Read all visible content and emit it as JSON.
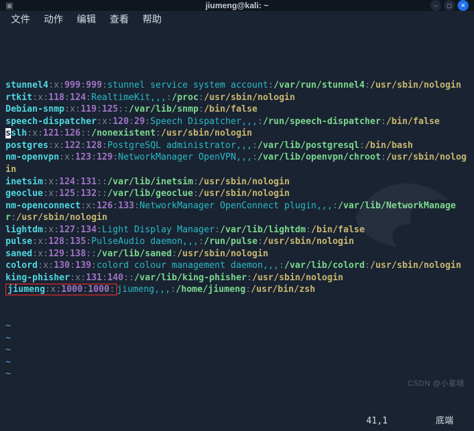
{
  "window": {
    "title": "jiumeng@kali: ~"
  },
  "menu": {
    "items": [
      "文件",
      "动作",
      "编辑",
      "查看",
      "帮助"
    ]
  },
  "lines": [
    {
      "segs": [
        {
          "t": "stunnel4",
          "c": "c-cyan"
        },
        {
          "t": ":",
          "c": "c-gray"
        },
        {
          "t": "x",
          "c": "c-gray"
        },
        {
          "t": ":",
          "c": "c-gray"
        },
        {
          "t": "999",
          "c": "c-purple"
        },
        {
          "t": ":",
          "c": "c-gray"
        },
        {
          "t": "999",
          "c": "c-purple"
        },
        {
          "t": ":",
          "c": "c-gray"
        },
        {
          "t": "stunnel service system account",
          "c": "c-teal"
        },
        {
          "t": ":",
          "c": "c-gray"
        },
        {
          "t": "/var/run/stunnel4",
          "c": "c-green"
        },
        {
          "t": ":",
          "c": "c-gray"
        },
        {
          "t": "/usr/sbin/nologin",
          "c": "c-yellow"
        }
      ]
    },
    {
      "segs": [
        {
          "t": "rtkit",
          "c": "c-cyan"
        },
        {
          "t": ":",
          "c": "c-gray"
        },
        {
          "t": "x",
          "c": "c-gray"
        },
        {
          "t": ":",
          "c": "c-gray"
        },
        {
          "t": "118",
          "c": "c-purple"
        },
        {
          "t": ":",
          "c": "c-gray"
        },
        {
          "t": "124",
          "c": "c-purple"
        },
        {
          "t": ":",
          "c": "c-gray"
        },
        {
          "t": "RealtimeKit,,,",
          "c": "c-teal"
        },
        {
          "t": ":",
          "c": "c-gray"
        },
        {
          "t": "/proc",
          "c": "c-green"
        },
        {
          "t": ":",
          "c": "c-gray"
        },
        {
          "t": "/usr/sbin/nologin",
          "c": "c-yellow"
        }
      ]
    },
    {
      "segs": [
        {
          "t": "Debian-snmp",
          "c": "c-cyan"
        },
        {
          "t": ":",
          "c": "c-gray"
        },
        {
          "t": "x",
          "c": "c-gray"
        },
        {
          "t": ":",
          "c": "c-gray"
        },
        {
          "t": "119",
          "c": "c-purple"
        },
        {
          "t": ":",
          "c": "c-gray"
        },
        {
          "t": "125",
          "c": "c-purple"
        },
        {
          "t": "::",
          "c": "c-gray"
        },
        {
          "t": "/var/lib/snmp",
          "c": "c-green"
        },
        {
          "t": ":",
          "c": "c-gray"
        },
        {
          "t": "/bin/false",
          "c": "c-yellow"
        }
      ]
    },
    {
      "segs": [
        {
          "t": "speech-dispatcher",
          "c": "c-cyan"
        },
        {
          "t": ":",
          "c": "c-gray"
        },
        {
          "t": "x",
          "c": "c-gray"
        },
        {
          "t": ":",
          "c": "c-gray"
        },
        {
          "t": "120",
          "c": "c-purple"
        },
        {
          "t": ":",
          "c": "c-gray"
        },
        {
          "t": "29",
          "c": "c-purple"
        },
        {
          "t": ":",
          "c": "c-gray"
        },
        {
          "t": "Speech Dispatcher,,,",
          "c": "c-teal"
        },
        {
          "t": ":",
          "c": "c-gray"
        },
        {
          "t": "/run/speech-dispatcher",
          "c": "c-green"
        },
        {
          "t": ":",
          "c": "c-gray"
        },
        {
          "t": "/bin/false",
          "c": "c-yellow"
        }
      ]
    },
    {
      "segs": [
        {
          "t": "s",
          "c": "c-cyan",
          "hl": "cursor"
        },
        {
          "t": "slh",
          "c": "c-cyan"
        },
        {
          "t": ":",
          "c": "c-gray"
        },
        {
          "t": "x",
          "c": "c-gray"
        },
        {
          "t": ":",
          "c": "c-gray"
        },
        {
          "t": "121",
          "c": "c-purple"
        },
        {
          "t": ":",
          "c": "c-gray"
        },
        {
          "t": "126",
          "c": "c-purple"
        },
        {
          "t": "::",
          "c": "c-gray"
        },
        {
          "t": "/nonexistent",
          "c": "c-green"
        },
        {
          "t": ":",
          "c": "c-gray"
        },
        {
          "t": "/usr/sbin/nologin",
          "c": "c-yellow"
        }
      ]
    },
    {
      "segs": [
        {
          "t": "postgres",
          "c": "c-cyan"
        },
        {
          "t": ":",
          "c": "c-gray"
        },
        {
          "t": "x",
          "c": "c-gray"
        },
        {
          "t": ":",
          "c": "c-gray"
        },
        {
          "t": "122",
          "c": "c-purple"
        },
        {
          "t": ":",
          "c": "c-gray"
        },
        {
          "t": "128",
          "c": "c-purple"
        },
        {
          "t": ":",
          "c": "c-gray"
        },
        {
          "t": "PostgreSQL administrator,,,",
          "c": "c-teal"
        },
        {
          "t": ":",
          "c": "c-gray"
        },
        {
          "t": "/var/lib/postgresql",
          "c": "c-green"
        },
        {
          "t": ":",
          "c": "c-gray"
        },
        {
          "t": "/bin/bash",
          "c": "c-yellow"
        }
      ]
    },
    {
      "segs": [
        {
          "t": "nm-openvpn",
          "c": "c-cyan"
        },
        {
          "t": ":",
          "c": "c-gray"
        },
        {
          "t": "x",
          "c": "c-gray"
        },
        {
          "t": ":",
          "c": "c-gray"
        },
        {
          "t": "123",
          "c": "c-purple"
        },
        {
          "t": ":",
          "c": "c-gray"
        },
        {
          "t": "129",
          "c": "c-purple"
        },
        {
          "t": ":",
          "c": "c-gray"
        },
        {
          "t": "NetworkManager OpenVPN,,,",
          "c": "c-teal"
        },
        {
          "t": ":",
          "c": "c-gray"
        },
        {
          "t": "/var/lib/openvpn/chroot",
          "c": "c-green"
        },
        {
          "t": ":",
          "c": "c-gray"
        },
        {
          "t": "/usr/sbin/nologin",
          "c": "c-yellow"
        }
      ]
    },
    {
      "segs": [
        {
          "t": "inetsim",
          "c": "c-cyan"
        },
        {
          "t": ":",
          "c": "c-gray"
        },
        {
          "t": "x",
          "c": "c-gray"
        },
        {
          "t": ":",
          "c": "c-gray"
        },
        {
          "t": "124",
          "c": "c-purple"
        },
        {
          "t": ":",
          "c": "c-gray"
        },
        {
          "t": "131",
          "c": "c-purple"
        },
        {
          "t": "::",
          "c": "c-gray"
        },
        {
          "t": "/var/lib/inetsim",
          "c": "c-green"
        },
        {
          "t": ":",
          "c": "c-gray"
        },
        {
          "t": "/usr/sbin/nologin",
          "c": "c-yellow"
        }
      ]
    },
    {
      "segs": [
        {
          "t": "geoclue",
          "c": "c-cyan"
        },
        {
          "t": ":",
          "c": "c-gray"
        },
        {
          "t": "x",
          "c": "c-gray"
        },
        {
          "t": ":",
          "c": "c-gray"
        },
        {
          "t": "125",
          "c": "c-purple"
        },
        {
          "t": ":",
          "c": "c-gray"
        },
        {
          "t": "132",
          "c": "c-purple"
        },
        {
          "t": "::",
          "c": "c-gray"
        },
        {
          "t": "/var/lib/geoclue",
          "c": "c-green"
        },
        {
          "t": ":",
          "c": "c-gray"
        },
        {
          "t": "/usr/sbin/nologin",
          "c": "c-yellow"
        }
      ]
    },
    {
      "segs": [
        {
          "t": "nm-openconnect",
          "c": "c-cyan"
        },
        {
          "t": ":",
          "c": "c-gray"
        },
        {
          "t": "x",
          "c": "c-gray"
        },
        {
          "t": ":",
          "c": "c-gray"
        },
        {
          "t": "126",
          "c": "c-purple"
        },
        {
          "t": ":",
          "c": "c-gray"
        },
        {
          "t": "133",
          "c": "c-purple"
        },
        {
          "t": ":",
          "c": "c-gray"
        },
        {
          "t": "NetworkManager OpenConnect plugin,,,",
          "c": "c-teal"
        },
        {
          "t": ":",
          "c": "c-gray"
        },
        {
          "t": "/var/lib/NetworkManager",
          "c": "c-green"
        },
        {
          "t": ":",
          "c": "c-gray"
        },
        {
          "t": "/usr/sbin/nologin",
          "c": "c-yellow"
        }
      ]
    },
    {
      "segs": [
        {
          "t": "lightdm",
          "c": "c-cyan"
        },
        {
          "t": ":",
          "c": "c-gray"
        },
        {
          "t": "x",
          "c": "c-gray"
        },
        {
          "t": ":",
          "c": "c-gray"
        },
        {
          "t": "127",
          "c": "c-purple"
        },
        {
          "t": ":",
          "c": "c-gray"
        },
        {
          "t": "134",
          "c": "c-purple"
        },
        {
          "t": ":",
          "c": "c-gray"
        },
        {
          "t": "Light Display Manager",
          "c": "c-teal"
        },
        {
          "t": ":",
          "c": "c-gray"
        },
        {
          "t": "/var/lib/lightdm",
          "c": "c-green"
        },
        {
          "t": ":",
          "c": "c-gray"
        },
        {
          "t": "/bin/false",
          "c": "c-yellow"
        }
      ]
    },
    {
      "segs": [
        {
          "t": "pulse",
          "c": "c-cyan"
        },
        {
          "t": ":",
          "c": "c-gray"
        },
        {
          "t": "x",
          "c": "c-gray"
        },
        {
          "t": ":",
          "c": "c-gray"
        },
        {
          "t": "128",
          "c": "c-purple"
        },
        {
          "t": ":",
          "c": "c-gray"
        },
        {
          "t": "135",
          "c": "c-purple"
        },
        {
          "t": ":",
          "c": "c-gray"
        },
        {
          "t": "PulseAudio daemon,,,",
          "c": "c-teal"
        },
        {
          "t": ":",
          "c": "c-gray"
        },
        {
          "t": "/run/pulse",
          "c": "c-green"
        },
        {
          "t": ":",
          "c": "c-gray"
        },
        {
          "t": "/usr/sbin/nologin",
          "c": "c-yellow"
        }
      ]
    },
    {
      "segs": [
        {
          "t": "saned",
          "c": "c-cyan"
        },
        {
          "t": ":",
          "c": "c-gray"
        },
        {
          "t": "x",
          "c": "c-gray"
        },
        {
          "t": ":",
          "c": "c-gray"
        },
        {
          "t": "129",
          "c": "c-purple"
        },
        {
          "t": ":",
          "c": "c-gray"
        },
        {
          "t": "138",
          "c": "c-purple"
        },
        {
          "t": "::",
          "c": "c-gray"
        },
        {
          "t": "/var/lib/saned",
          "c": "c-green"
        },
        {
          "t": ":",
          "c": "c-gray"
        },
        {
          "t": "/usr/sbin/nologin",
          "c": "c-yellow"
        }
      ]
    },
    {
      "segs": [
        {
          "t": "colord",
          "c": "c-cyan"
        },
        {
          "t": ":",
          "c": "c-gray"
        },
        {
          "t": "x",
          "c": "c-gray"
        },
        {
          "t": ":",
          "c": "c-gray"
        },
        {
          "t": "130",
          "c": "c-purple"
        },
        {
          "t": ":",
          "c": "c-gray"
        },
        {
          "t": "139",
          "c": "c-purple"
        },
        {
          "t": ":",
          "c": "c-gray"
        },
        {
          "t": "colord colour management daemon,,,",
          "c": "c-teal"
        },
        {
          "t": ":",
          "c": "c-gray"
        },
        {
          "t": "/var/lib/colord",
          "c": "c-green"
        },
        {
          "t": ":",
          "c": "c-gray"
        },
        {
          "t": "/usr/sbin/nologin",
          "c": "c-yellow"
        }
      ]
    },
    {
      "segs": [
        {
          "t": "king-phisher",
          "c": "c-cyan"
        },
        {
          "t": ":",
          "c": "c-gray"
        },
        {
          "t": "x",
          "c": "c-gray"
        },
        {
          "t": ":",
          "c": "c-gray"
        },
        {
          "t": "131",
          "c": "c-purple"
        },
        {
          "t": ":",
          "c": "c-gray"
        },
        {
          "t": "140",
          "c": "c-purple"
        },
        {
          "t": "::",
          "c": "c-gray"
        },
        {
          "t": "/var/lib/king-phisher",
          "c": "c-green"
        },
        {
          "t": ":",
          "c": "c-gray"
        },
        {
          "t": "/usr/sbin/nologin",
          "c": "c-yellow"
        }
      ]
    },
    {
      "segs": [
        {
          "t": "jiumeng",
          "c": "c-cyan",
          "box": "start"
        },
        {
          "t": ":",
          "c": "c-gray"
        },
        {
          "t": "x",
          "c": "c-gray"
        },
        {
          "t": ":",
          "c": "c-gray"
        },
        {
          "t": "1000",
          "c": "c-purple"
        },
        {
          "t": ":",
          "c": "c-gray"
        },
        {
          "t": "1000",
          "c": "c-purple"
        },
        {
          "t": ":",
          "c": "c-gray",
          "box": "end"
        },
        {
          "t": "jiumeng,,,",
          "c": "c-teal"
        },
        {
          "t": ":",
          "c": "c-gray"
        },
        {
          "t": "/home/jiumeng",
          "c": "c-green"
        },
        {
          "t": ":",
          "c": "c-gray"
        },
        {
          "t": "/usr/bin/zsh",
          "c": "c-yellow"
        }
      ]
    }
  ],
  "tildes": [
    "~",
    "~",
    "~",
    "~",
    "~"
  ],
  "status": {
    "pos": "41,1",
    "mode": "底端"
  },
  "watermark": "CSDN @小星晴"
}
